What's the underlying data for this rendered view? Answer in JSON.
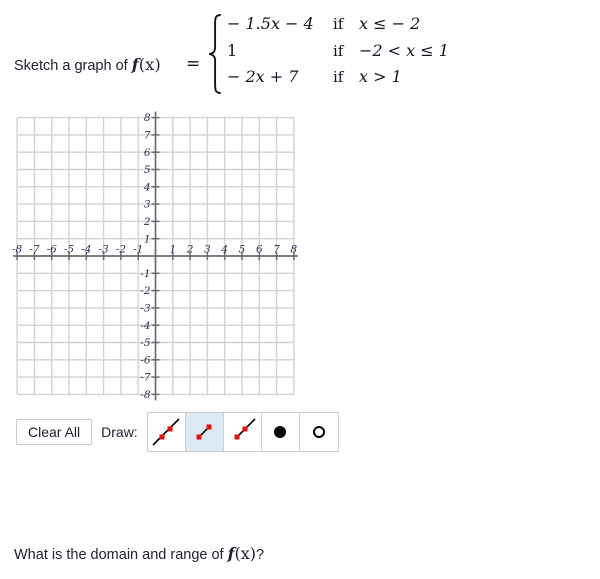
{
  "prompt": {
    "lead_text": "Sketch a graph of ",
    "function_name": "f",
    "function_arg": "(x)",
    "equals": "=",
    "cases": [
      {
        "expr": "− 1.5x − 4",
        "if": "if",
        "cond": "x ≤ − 2"
      },
      {
        "expr": "1",
        "if": "if",
        "cond": "−2 < x ≤ 1"
      },
      {
        "expr": "− 2x + 7",
        "if": "if",
        "cond": "x > 1"
      }
    ]
  },
  "graph": {
    "x_ticks": [
      "-8",
      "-7",
      "-6",
      "-5",
      "-4",
      "-3",
      "-2",
      "-1",
      "1",
      "2",
      "3",
      "4",
      "5",
      "6",
      "7",
      "8"
    ],
    "y_ticks": [
      "8",
      "7",
      "6",
      "5",
      "4",
      "3",
      "2",
      "1",
      "-1",
      "-2",
      "-3",
      "-4",
      "-5",
      "-6",
      "-7",
      "-8"
    ],
    "x_min": -8,
    "x_max": 8,
    "y_min": -8,
    "y_max": 8,
    "grid_color": "#d2d2d2",
    "axis_color": "#6b6b6b",
    "label_color": "#2a2a55",
    "plotted_series": []
  },
  "toolbar": {
    "clear_all_label": "Clear All",
    "draw_label": "Draw:",
    "tools": [
      {
        "name": "line-tool",
        "selected": false
      },
      {
        "name": "segment-tool",
        "selected": true
      },
      {
        "name": "ray-tool",
        "selected": false
      },
      {
        "name": "filled-dot-tool",
        "selected": false
      },
      {
        "name": "open-dot-tool",
        "selected": false
      }
    ],
    "point_color": "#e11010",
    "selected_background": "#dce9f5"
  },
  "question": {
    "lead_text": "What is the domain and range of ",
    "function_name": "f",
    "function_arg": "(x)",
    "trailing": "?"
  }
}
